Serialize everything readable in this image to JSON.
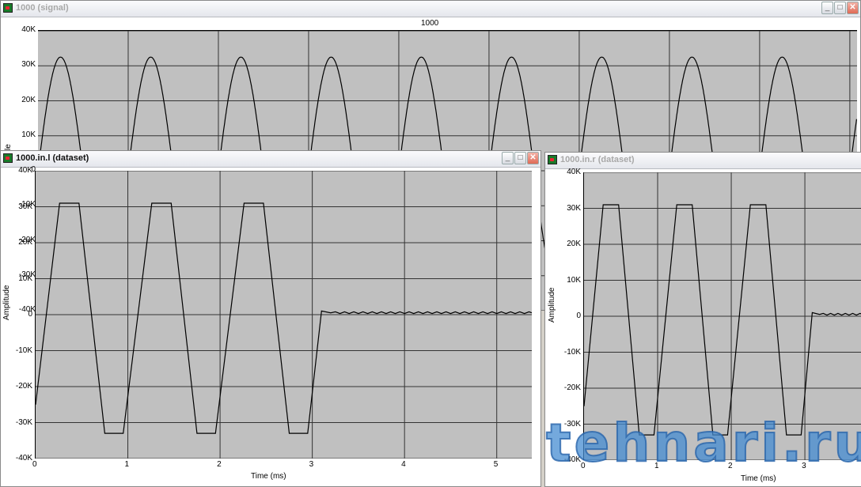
{
  "windows": {
    "signal": {
      "title": "1000 (signal)",
      "active": false
    },
    "left": {
      "title": "1000.in.l (dataset)",
      "active": true
    },
    "right": {
      "title": "1000.in.r (dataset)",
      "active": false
    }
  },
  "watermark": "tehnari.ru",
  "chart_data": [
    {
      "id": "signal",
      "type": "line",
      "title": "1000",
      "xlabel": "",
      "ylabel": "Amplitude",
      "ylabel_visible": "le",
      "ylim": [
        -40000,
        40000
      ],
      "xlim": [
        0,
        9.08
      ],
      "xticks": [
        0,
        1,
        2,
        3,
        4,
        5,
        6,
        7,
        8,
        9
      ],
      "yticks": [
        40000,
        30000,
        20000,
        10000,
        0,
        -10000,
        -20000,
        -30000,
        -40000
      ],
      "ytick_labels": [
        "40K",
        "30K",
        "20K",
        "10K",
        "0",
        "-10K",
        "-20K",
        "-30K",
        "-40K"
      ],
      "series": [
        {
          "name": "signal",
          "kind": "sine",
          "amplitude": 32500,
          "period": 1,
          "color": "#000000"
        }
      ]
    },
    {
      "id": "left",
      "type": "line",
      "title": "",
      "xlabel": "Time (ms)",
      "ylabel": "Amplitude",
      "ylim": [
        -40000,
        40000
      ],
      "xlim": [
        0,
        5.38
      ],
      "xticks": [
        0,
        1,
        2,
        3,
        4,
        5
      ],
      "xtick_labels": [
        "0",
        "1",
        "2",
        "3",
        "4",
        "5"
      ],
      "yticks": [
        40000,
        30000,
        20000,
        10000,
        0,
        -10000,
        -20000,
        -30000,
        -40000
      ],
      "ytick_labels": [
        "40K",
        "30K",
        "20K",
        "10K",
        "0",
        "-10K",
        "-20K",
        "-30K",
        "-40K"
      ],
      "series": [
        {
          "name": "1000.in.l",
          "color": "#000000",
          "points": [
            [
              0,
              -25000
            ],
            [
              0.26,
              31000
            ],
            [
              0.47,
              31000
            ],
            [
              0.75,
              -33000
            ],
            [
              0.95,
              -33000
            ],
            [
              1.26,
              31000
            ],
            [
              1.47,
              31000
            ],
            [
              1.75,
              -33000
            ],
            [
              1.95,
              -33000
            ],
            [
              2.26,
              31000
            ],
            [
              2.47,
              31000
            ],
            [
              2.75,
              -33000
            ],
            [
              2.95,
              -33000
            ],
            [
              3.1,
              1000
            ],
            [
              3.2,
              500
            ],
            [
              5.38,
              500
            ]
          ]
        }
      ]
    },
    {
      "id": "right",
      "type": "line",
      "title": "",
      "xlabel": "Time (ms)",
      "ylabel": "Amplitude",
      "ylim": [
        -40000,
        40000
      ],
      "xlim": [
        0,
        3.87
      ],
      "xticks": [
        0,
        1,
        2,
        3
      ],
      "xtick_labels": [
        "0",
        "1",
        "2",
        "3"
      ],
      "yticks": [
        40000,
        30000,
        20000,
        10000,
        0,
        -10000,
        -20000,
        -30000,
        -40000
      ],
      "ytick_labels": [
        "40K",
        "30K",
        "20K",
        "10K",
        "0",
        "-10K",
        "-20K",
        "-30K",
        "-40K"
      ],
      "series": [
        {
          "name": "1000.in.r",
          "color": "#000000",
          "points": [
            [
              0,
              -25000
            ],
            [
              0.26,
              31000
            ],
            [
              0.47,
              31000
            ],
            [
              0.75,
              -33000
            ],
            [
              0.95,
              -33000
            ],
            [
              1.26,
              31000
            ],
            [
              1.47,
              31000
            ],
            [
              1.75,
              -33000
            ],
            [
              1.95,
              -33000
            ],
            [
              2.26,
              31000
            ],
            [
              2.47,
              31000
            ],
            [
              2.75,
              -33000
            ],
            [
              2.95,
              -33000
            ],
            [
              3.1,
              1000
            ],
            [
              3.2,
              500
            ],
            [
              3.87,
              500
            ]
          ]
        }
      ]
    }
  ]
}
